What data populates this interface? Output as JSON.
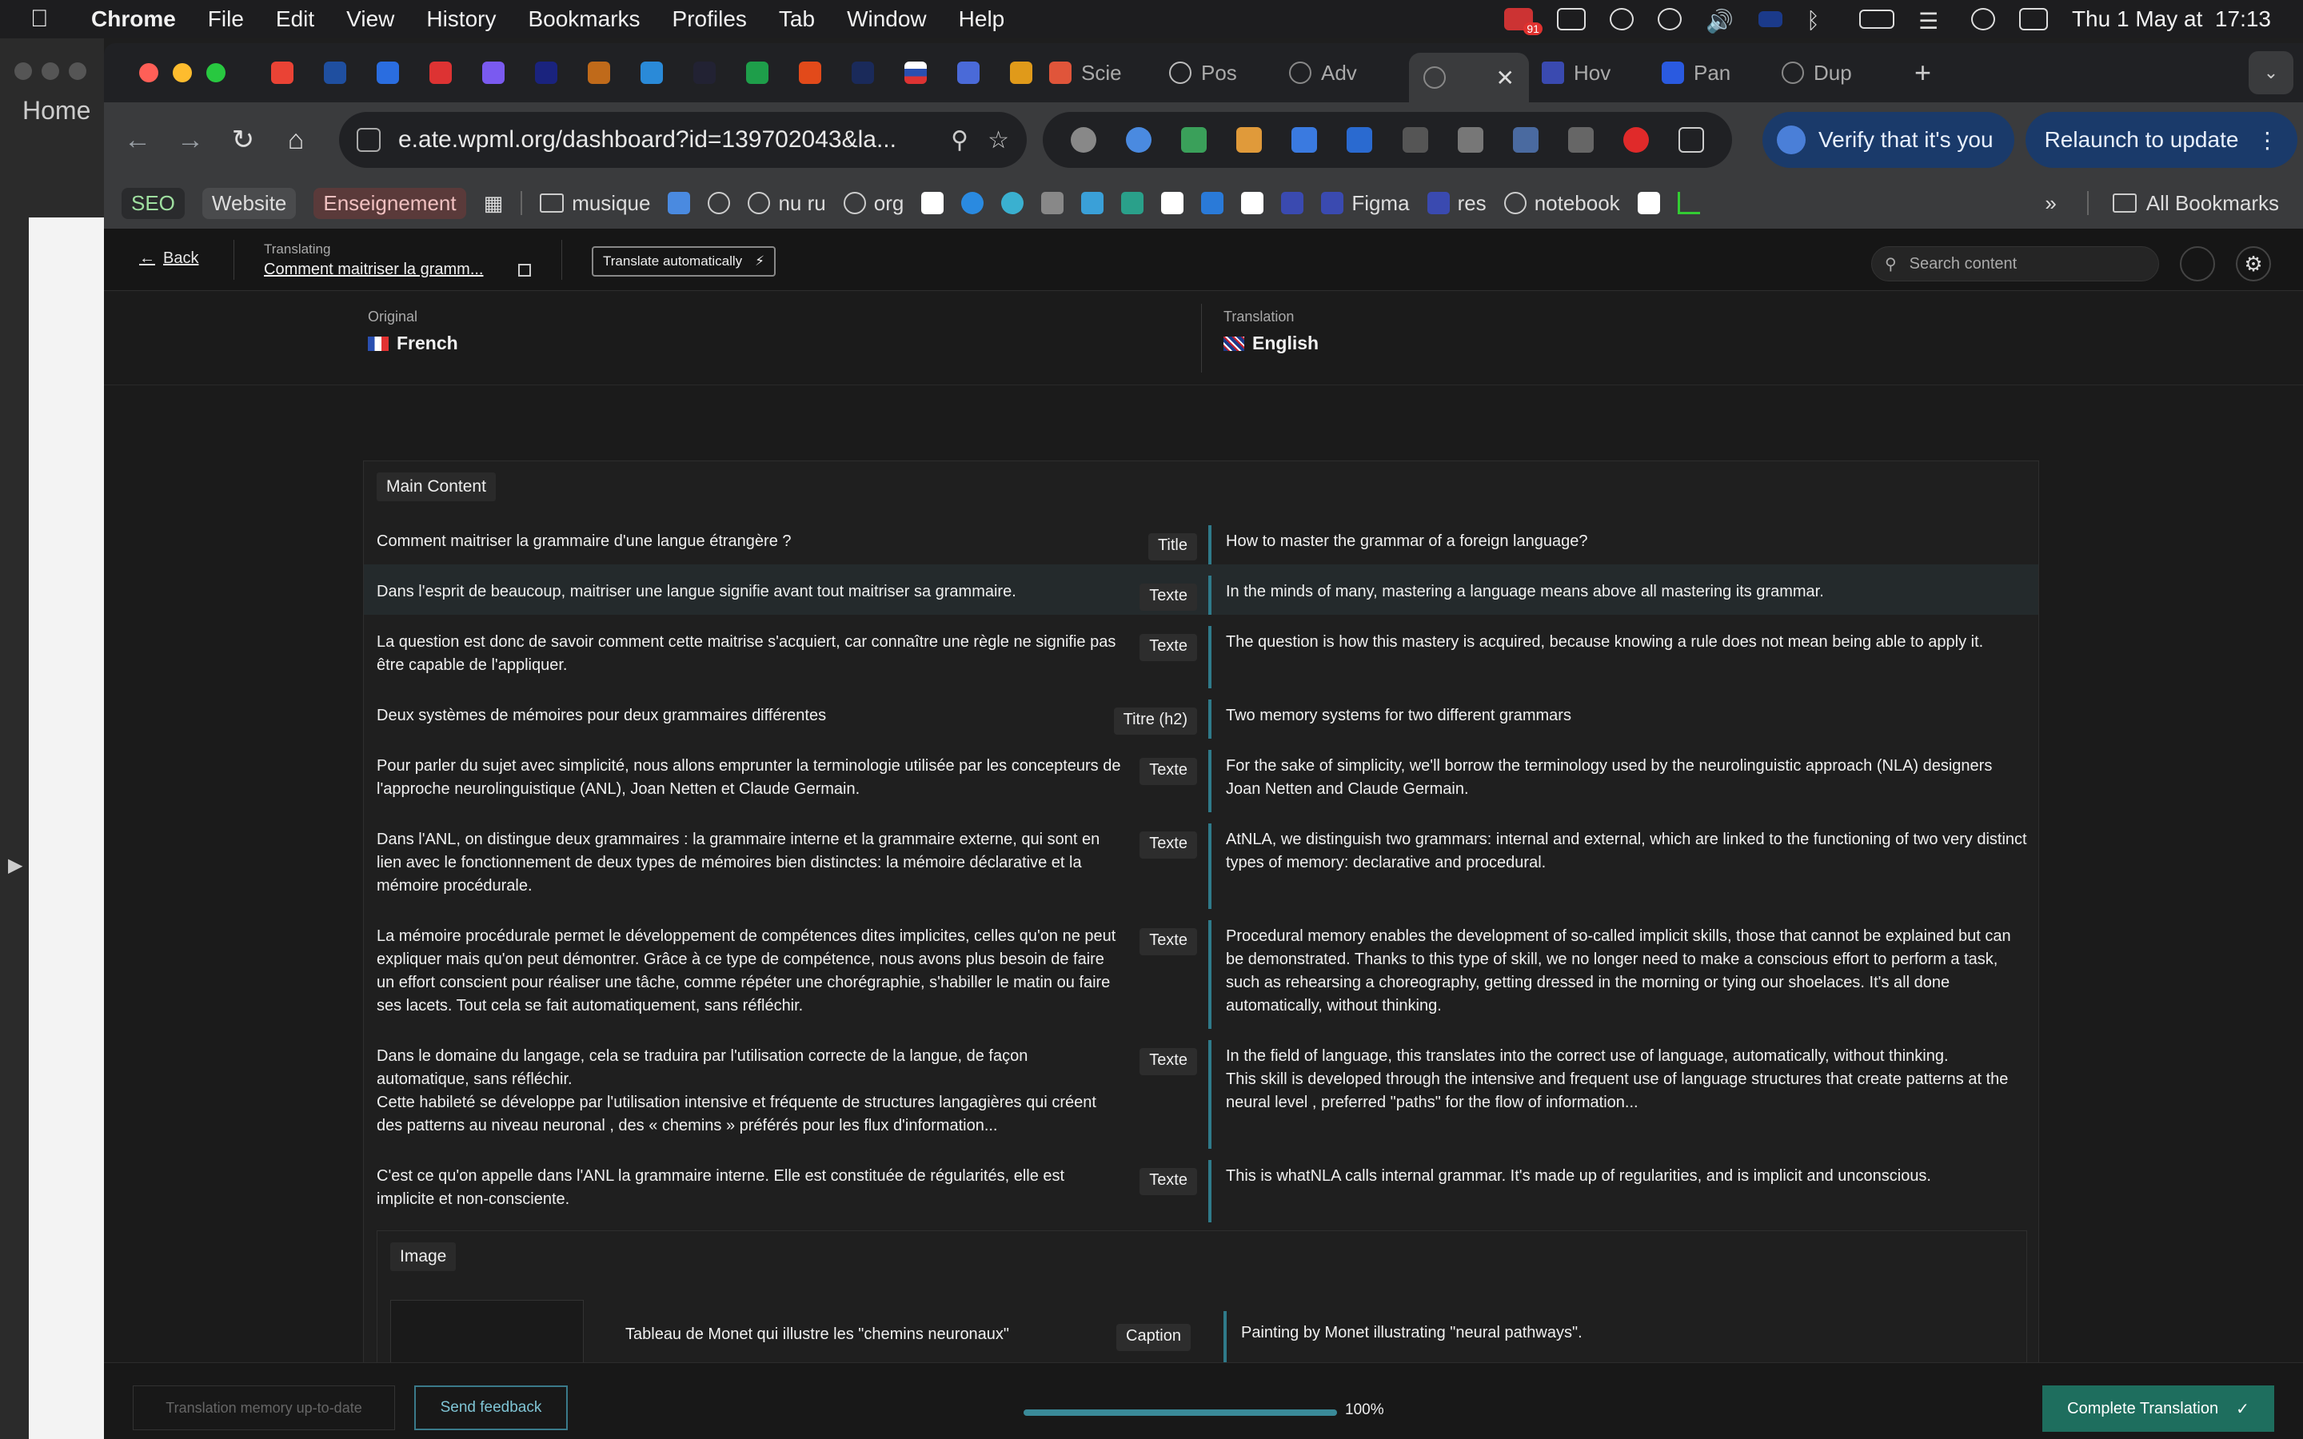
{
  "menubar": {
    "app": "Chrome",
    "items": [
      "File",
      "Edit",
      "View",
      "History",
      "Bookmarks",
      "Profiles",
      "Tab",
      "Window",
      "Help"
    ],
    "notif_badge": "91",
    "clock": "Thu 1 May at  17:13"
  },
  "bg_window": {
    "home": "Home"
  },
  "tabs": [
    {
      "label": "Scie"
    },
    {
      "label": "Pos"
    },
    {
      "label": "Adv"
    },
    {
      "label": ""
    },
    {
      "label": "Hov"
    },
    {
      "label": "Pan"
    },
    {
      "label": "Dup"
    }
  ],
  "toolbar": {
    "url": "e.ate.wpml.org/dashboard?id=139702043&la...",
    "verify": "Verify that it's you",
    "relaunch": "Relaunch to update"
  },
  "bookmarks": {
    "items": [
      "SEO",
      "Website",
      "Enseignement",
      "musique",
      "nu ru",
      "org",
      "Figma",
      "res",
      "notebook"
    ],
    "all": "All Bookmarks"
  },
  "app": {
    "back": "Back",
    "translating_label": "Translating",
    "doc_title": "Comment maitriser la gramm...",
    "auto_translate": "Translate automatically",
    "search_placeholder": "Search content"
  },
  "languages": {
    "original_label": "Original",
    "original": "French",
    "translation_label": "Translation",
    "translation": "English"
  },
  "main_section": "Main Content",
  "rows": [
    {
      "src": "Comment maitriser la grammaire d'une langue étrangère ?",
      "type": "Title",
      "tr": "How to master the grammar of a foreign language?"
    },
    {
      "src": "Dans l'esprit de beaucoup, maitriser une langue signifie avant tout maitriser sa grammaire.",
      "type": "Texte",
      "tr": "In the minds of many, mastering a language means above all mastering its grammar."
    },
    {
      "src": "La question est donc de savoir comment cette maitrise s'acquiert, car connaître une règle ne signifie pas être capable de l'appliquer.",
      "type": "Texte",
      "tr": "The question is how this mastery is acquired, because knowing a rule does not mean being able to apply it."
    },
    {
      "src": "Deux systèmes de mémoires pour deux grammaires différentes",
      "type": "Titre (h2)",
      "tr": "Two memory systems for two different grammars"
    },
    {
      "src": "Pour parler du sujet avec simplicité, nous allons emprunter la terminologie utilisée par les concepteurs de l'approche neurolinguistique (ANL), Joan Netten et Claude Germain.",
      "type": "Texte",
      "tr": "For the sake of simplicity, we'll borrow the terminology used by the neurolinguistic approach (NLA) designers Joan Netten and Claude Germain."
    },
    {
      "src": "Dans l'ANL, on distingue deux grammaires : la grammaire interne et la grammaire externe, qui sont en lien avec le fonctionnement de deux types de mémoires bien distinctes: la mémoire déclarative et la mémoire procédurale.",
      "type": "Texte",
      "tr": "AtNLA, we distinguish two grammars: internal and external, which are linked to the functioning of two very distinct types of memory: declarative and procedural."
    },
    {
      "src": "La mémoire procédurale permet le développement de compétences dites implicites, celles qu'on ne peut expliquer mais qu'on peut démontrer. Grâce à ce type de compétence, nous avons plus besoin de faire un effort conscient pour réaliser une tâche, comme répéter une chorégraphie, s'habiller le matin ou faire ses lacets. Tout cela se fait automatiquement, sans réfléchir.",
      "type": "Texte",
      "tr": "Procedural memory enables the development of so-called implicit skills, those that cannot be explained but can be demonstrated. Thanks to this type of skill, we no longer need to make a conscious effort to perform a task, such as rehearsing a choreography, getting dressed in the morning or tying our shoelaces. It's all done automatically, without thinking."
    },
    {
      "src": "Dans le domaine du langage, cela se traduira par l'utilisation correcte de la langue, de façon automatique, sans réfléchir.\nCette habileté se développe par l'utilisation intensive et fréquente de structures langagières qui créent des patterns au niveau neuronal , des « chemins » préférés pour les flux d'information...",
      "type": "Texte",
      "tr": "In the field of language, this translates into the correct use of language, automatically, without thinking.\nThis skill is developed through the intensive and frequent use of language structures that create patterns at the neural level , preferred \"paths\" for the flow of information..."
    },
    {
      "src": "C'est ce qu'on appelle dans l'ANL la grammaire interne. Elle est constituée de régularités, elle est implicite et non-consciente.",
      "type": "Texte",
      "tr": "This is whatNLA calls internal grammar. It's made up of regularities, and is implicit and unconscious."
    }
  ],
  "image_section": {
    "label": "Image",
    "caption_src": "Tableau de Monet qui illustre les \"chemins neuronaux\"",
    "caption_type": "Caption",
    "caption_tr": "Painting by Monet illustrating \"neural pathways\"."
  },
  "footer": {
    "tm": "Translation memory up-to-date",
    "feedback": "Send feedback",
    "progress": 100,
    "progress_label": "100%",
    "complete": "Complete Translation"
  },
  "colors": {
    "accent": "#2f7a8a",
    "complete_bg": "#1e6e5e",
    "close_red": "#ff5f57",
    "min_yellow": "#febc2e",
    "max_green": "#28c840"
  }
}
